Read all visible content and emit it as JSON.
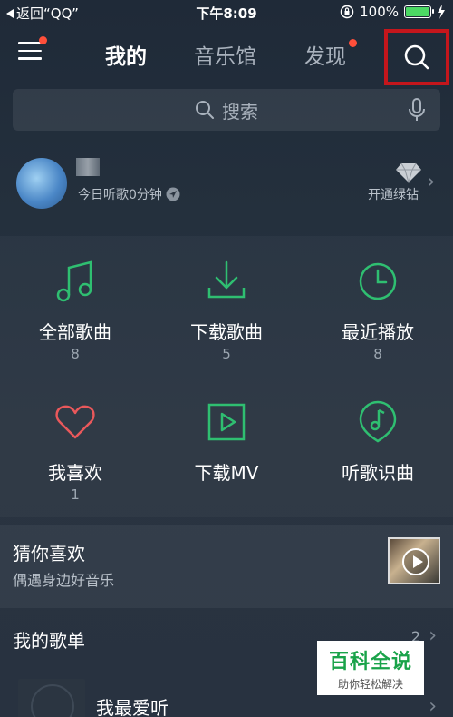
{
  "status_bar": {
    "back_label": "返回“QQ”",
    "time": "下午8:09",
    "battery": "100%",
    "battery_level": 1.0
  },
  "nav": {
    "tabs": [
      {
        "label": "我的",
        "active": true
      },
      {
        "label": "音乐馆",
        "active": false
      },
      {
        "label": "发现",
        "active": false,
        "has_badge": true
      }
    ],
    "menu_has_badge": true,
    "search_icon": "search-icon"
  },
  "search": {
    "placeholder": "搜索",
    "icon": "search-icon",
    "voice_icon": "mic-icon"
  },
  "profile": {
    "listen_time": "今日听歌0分钟",
    "vip_label": "开通绿钻"
  },
  "grid": [
    {
      "label": "全部歌曲",
      "count": "8",
      "icon": "music-note-icon"
    },
    {
      "label": "下载歌曲",
      "count": "5",
      "icon": "download-icon"
    },
    {
      "label": "最近播放",
      "count": "8",
      "icon": "clock-icon"
    },
    {
      "label": "我喜欢",
      "count": "1",
      "icon": "heart-icon"
    },
    {
      "label": "下载MV",
      "count": "",
      "icon": "video-play-icon"
    },
    {
      "label": "听歌识曲",
      "count": "",
      "icon": "song-recognition-icon"
    }
  ],
  "guess": {
    "title": "猜你喜欢",
    "subtitle": "偶遇身边好音乐"
  },
  "playlists": {
    "title": "我的歌单",
    "count": "2",
    "items": [
      {
        "name": "我最爱听"
      }
    ]
  },
  "watermark": {
    "top": "百科全说",
    "bottom": "助你轻松解决"
  },
  "colors": {
    "accent_green": "#2fbf71",
    "heart_red": "#e9585b",
    "badge_red": "#ff4f3a",
    "highlight_red": "#c4161c"
  }
}
